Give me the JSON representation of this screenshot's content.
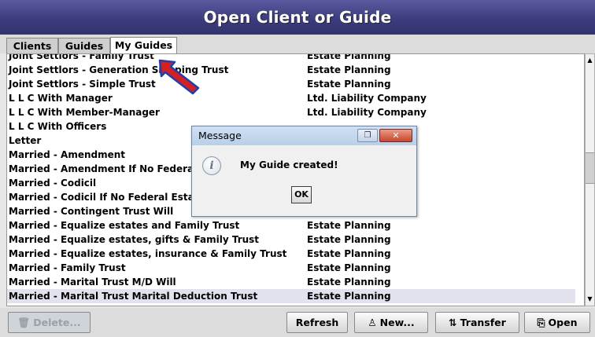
{
  "window": {
    "title": "Open Client or Guide"
  },
  "tabs": [
    {
      "label": "Clients",
      "active": false
    },
    {
      "label": "Guides",
      "active": false
    },
    {
      "label": "My Guides",
      "active": true
    }
  ],
  "rows": [
    {
      "name": "Joint Settlors - Family Trust",
      "category": "Estate Planning"
    },
    {
      "name": "Joint Settlors - Generation Skipping Trust",
      "category": "Estate Planning"
    },
    {
      "name": "Joint Settlors - Simple Trust",
      "category": "Estate Planning"
    },
    {
      "name": "L L C With Manager",
      "category": "Ltd. Liability Company"
    },
    {
      "name": "L L C With Member-Manager",
      "category": "Ltd. Liability Company"
    },
    {
      "name": "L L C With Officers",
      "category": ""
    },
    {
      "name": "Letter",
      "category": ""
    },
    {
      "name": "Married - Amendment",
      "category": ""
    },
    {
      "name": "Married - Amendment If No Federal Estate Tax",
      "category": ""
    },
    {
      "name": "Married - Codicil",
      "category": ""
    },
    {
      "name": "Married - Codicil If No Federal Estate Tax",
      "category": ""
    },
    {
      "name": "Married - Contingent Trust Will",
      "category": ""
    },
    {
      "name": "Married - Equalize estates and Family Trust",
      "category": "Estate Planning"
    },
    {
      "name": "Married - Equalize estates, gifts & Family Trust",
      "category": "Estate Planning"
    },
    {
      "name": "Married - Equalize estates, insurance & Family Trust",
      "category": "Estate Planning"
    },
    {
      "name": "Married - Family Trust",
      "category": "Estate Planning"
    },
    {
      "name": "Married - Marital Trust M/D Will",
      "category": "Estate Planning"
    },
    {
      "name": "Married - Marital Trust Marital Deduction Trust",
      "category": "Estate Planning",
      "selected": true
    }
  ],
  "buttons": {
    "delete": "Delete...",
    "refresh": "Refresh",
    "new": "New...",
    "transfer": "Transfer",
    "open": "Open"
  },
  "dialog": {
    "title": "Message",
    "message": "My Guide created!",
    "ok": "OK"
  },
  "colors": {
    "title_bg": "#3c3c7e",
    "arrow_fill": "#d42020",
    "arrow_outline": "#1f3fae",
    "selected_row": "#e2e2ee"
  }
}
